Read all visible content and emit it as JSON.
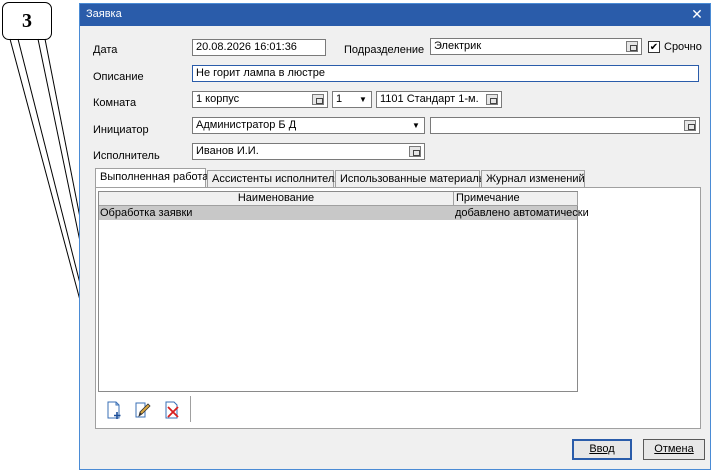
{
  "callout": {
    "number": "3"
  },
  "window": {
    "title": "Заявка",
    "close_glyph": "✕"
  },
  "form": {
    "date": {
      "label": "Дата",
      "value": "20.08.2026 16:01:36"
    },
    "department": {
      "label": "Подразделение",
      "value": "Электрик"
    },
    "urgent": {
      "label": "Срочно",
      "checked": true,
      "check_glyph": "✔"
    },
    "description": {
      "label": "Описание",
      "value": "Не горит лампа в люстре"
    },
    "room": {
      "label": "Комната",
      "building": "1 корпус",
      "floor": "1",
      "room": "1101  Стандарт 1-м."
    },
    "initiator": {
      "label": "Инициатор",
      "value": "Администратор Б Д",
      "extra": ""
    },
    "executor": {
      "label": "Исполнитель",
      "value": "Иванов И.И."
    }
  },
  "tabs": [
    {
      "label": "Выполненная работа",
      "active": true
    },
    {
      "label": "Ассистенты исполнителя",
      "active": false
    },
    {
      "label": "Использованные материалы",
      "active": false
    },
    {
      "label": "Журнал изменений",
      "active": false
    }
  ],
  "work_table": {
    "columns": [
      "Наименование",
      "Примечание"
    ],
    "rows": [
      {
        "name": "Обработка заявки",
        "note": "добавлено автоматически"
      }
    ]
  },
  "toolbar": {
    "add_icon": "document-add-icon",
    "edit_icon": "pencil-icon",
    "delete_icon": "document-delete-icon"
  },
  "buttons": {
    "ok_label": "Ввод",
    "cancel_label": "Отмена"
  },
  "colors": {
    "titlebar": "#2a5caa",
    "row_selected": "#c8c8c8",
    "dialog_bg": "#f0f0f0",
    "delete_red": "#d81e1e"
  }
}
